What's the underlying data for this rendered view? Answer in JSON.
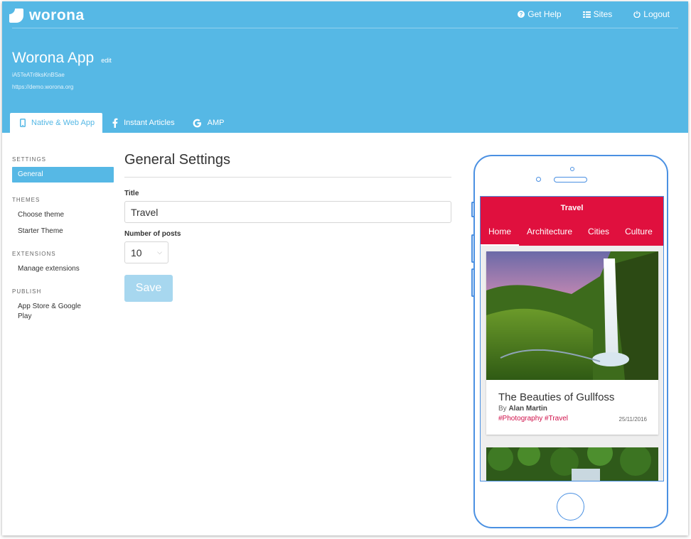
{
  "colors": {
    "header": "#56b8e5",
    "brand_red": "#e0103e",
    "phone_outline": "#4a90e2",
    "save_disabled": "#a7d7ef"
  },
  "header": {
    "logo": "worona",
    "nav": [
      {
        "label": "Get Help",
        "icon": "question-circle-icon"
      },
      {
        "label": "Sites",
        "icon": "grid-list-icon"
      },
      {
        "label": "Logout",
        "icon": "power-icon"
      }
    ],
    "app_title": "Worona App",
    "edit_label": "edit",
    "app_id": "iA5TeATr8ksKnBSae",
    "app_url": "https://demo.worona.org",
    "tabs": [
      {
        "label": "Native & Web App",
        "icon": "mobile-phone-icon",
        "active": true
      },
      {
        "label": "Instant Articles",
        "icon": "facebook-icon",
        "active": false
      },
      {
        "label": "AMP",
        "icon": "google-icon",
        "active": false
      }
    ]
  },
  "sidebar": {
    "sections": [
      {
        "heading": "SETTINGS",
        "items": [
          "General"
        ]
      },
      {
        "heading": "THEMES",
        "items": [
          "Choose theme",
          "Starter Theme"
        ]
      },
      {
        "heading": "EXTENSIONS",
        "items": [
          "Manage extensions"
        ]
      },
      {
        "heading": "PUBLISH",
        "items": [
          "App Store & Google Play"
        ]
      }
    ],
    "active_item": "General"
  },
  "main": {
    "heading": "General Settings",
    "title_label": "Title",
    "title_value": "Travel",
    "posts_label": "Number of posts",
    "posts_value": "10",
    "save_label": "Save"
  },
  "preview": {
    "bar_title": "Travel",
    "menu": [
      "Home",
      "Architecture",
      "Cities",
      "Culture"
    ],
    "active_menu": "Home",
    "post": {
      "title": "The Beauties of Gullfoss",
      "author_prefix": "By",
      "author": "Alan Martin",
      "tags": "#Photography #Travel",
      "date": "25/11/2016"
    }
  }
}
